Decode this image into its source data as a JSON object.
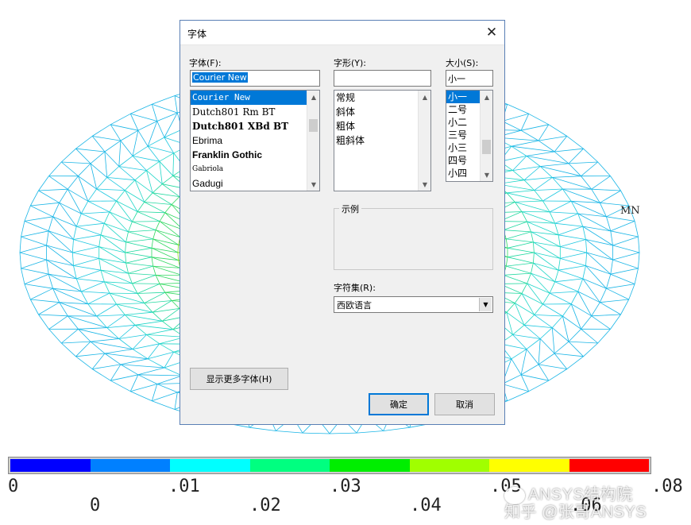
{
  "background": {
    "node_label": "MN",
    "legend": {
      "colors": [
        "#0000ff",
        "#0080ff",
        "#00ffff",
        "#00ff80",
        "#00ee00",
        "#a0ff00",
        "#ffff00",
        "#ff0000"
      ],
      "ticks_upper": [
        "0",
        ".01",
        ".03",
        ".05",
        ".08"
      ],
      "ticks_lower": [
        "0",
        ".02",
        ".04",
        ".06"
      ]
    },
    "watermark": {
      "line1": "ANSYS结构院",
      "line2": "知乎 @张哥ANSYS"
    }
  },
  "dialog": {
    "title": "字体",
    "font": {
      "label": "字体(F):",
      "value": "Courier New",
      "items": [
        "Courier New",
        "Dutch801 Rm BT",
        "Dutch801 XBd BT",
        "Ebrima",
        "Franklin Gothic",
        "Gabriola",
        "Gadugi"
      ]
    },
    "style": {
      "label": "字形(Y):",
      "value": "",
      "items": [
        "常规",
        "斜体",
        "粗体",
        "粗斜体"
      ]
    },
    "size": {
      "label": "大小(S):",
      "value": "小一",
      "items": [
        "小一",
        "二号",
        "小二",
        "三号",
        "小三",
        "四号",
        "小四"
      ]
    },
    "sample": {
      "label": "示例"
    },
    "charset": {
      "label": "字符集(R):",
      "value": "西欧语言"
    },
    "more_fonts_label": "显示更多字体(H)",
    "ok_label": "确定",
    "cancel_label": "取消"
  }
}
